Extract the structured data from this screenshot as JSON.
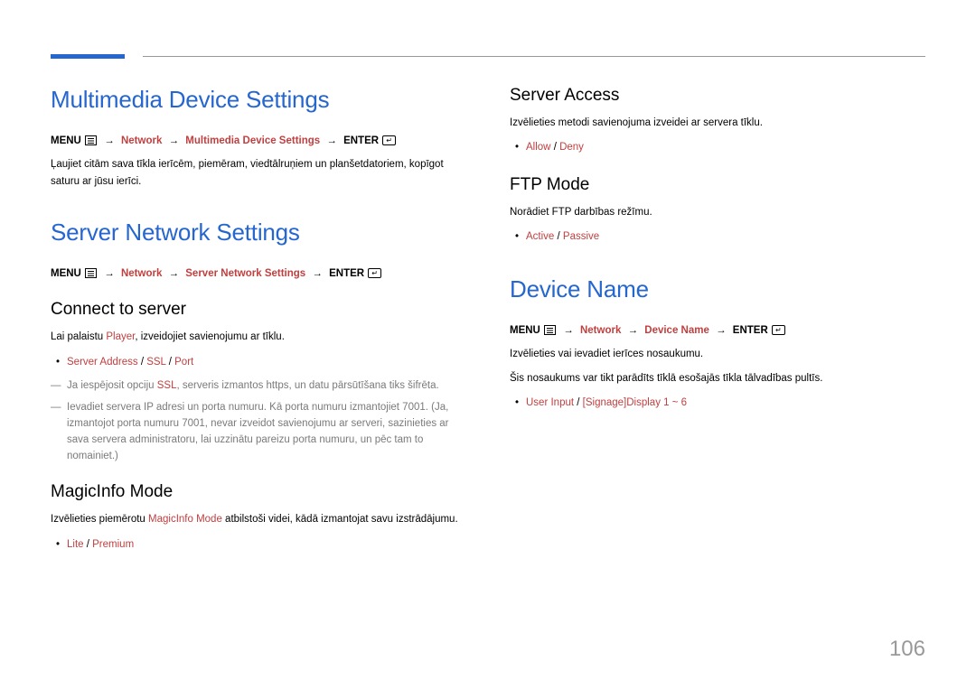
{
  "page_number": "106",
  "left": {
    "multimedia": {
      "title": "Multimedia Device Settings",
      "crumb_menu": "MENU",
      "crumb_network": "Network",
      "crumb_this": "Multimedia Device Settings",
      "crumb_enter": "ENTER",
      "desc": "Ļaujiet citām sava tīkla ierīcēm, piemēram, viedtālruņiem un planšetdatoriem, kopīgot saturu ar jūsu ierīci."
    },
    "server_net": {
      "title": "Server Network Settings",
      "crumb_menu": "MENU",
      "crumb_network": "Network",
      "crumb_this": "Server Network Settings",
      "crumb_enter": "ENTER",
      "connect": {
        "heading": "Connect to server",
        "desc_pre": "Lai palaistu ",
        "desc_hl": "Player",
        "desc_post": ", izveidojiet savienojumu ar tīklu.",
        "opt_server_address": "Server Address",
        "opt_ssl": "SSL",
        "opt_port": "Port",
        "note1_pre": "Ja iespējosit opciju ",
        "note1_hl": "SSL",
        "note1_post": ", serveris izmantos https, un datu pārsūtīšana tiks šifrēta.",
        "note2": "Ievadiet servera IP adresi un porta numuru. Kā porta numuru izmantojiet 7001. (Ja, izmantojot porta numuru 7001, nevar izveidot savienojumu ar serveri, sazinieties ar sava servera administratoru, lai uzzinātu pareizu porta numuru, un pēc tam to nomainiet.)"
      },
      "magicinfo": {
        "heading": "MagicInfo Mode",
        "desc_pre": "Izvēlieties piemērotu ",
        "desc_hl": "MagicInfo Mode",
        "desc_post": " atbilstoši videi, kādā izmantojat savu izstrādājumu.",
        "opt_lite": "Lite",
        "opt_premium": "Premium"
      }
    }
  },
  "right": {
    "server_access": {
      "heading": "Server Access",
      "desc": "Izvēlieties metodi savienojuma izveidei ar servera tīklu.",
      "opt_allow": "Allow",
      "opt_deny": "Deny"
    },
    "ftp": {
      "heading": "FTP Mode",
      "desc": "Norādiet FTP darbības režīmu.",
      "opt_active": "Active",
      "opt_passive": "Passive"
    },
    "device_name": {
      "title": "Device Name",
      "crumb_menu": "MENU",
      "crumb_network": "Network",
      "crumb_this": "Device Name",
      "crumb_enter": "ENTER",
      "desc1": "Izvēlieties vai ievadiet ierīces nosaukumu.",
      "desc2": "Šis nosaukums var tikt parādīts tīklā esošajās tīkla tālvadības pultīs.",
      "opt_user_input": "User Input",
      "opt_signage": "[Signage]Display 1 ~ 6"
    }
  }
}
